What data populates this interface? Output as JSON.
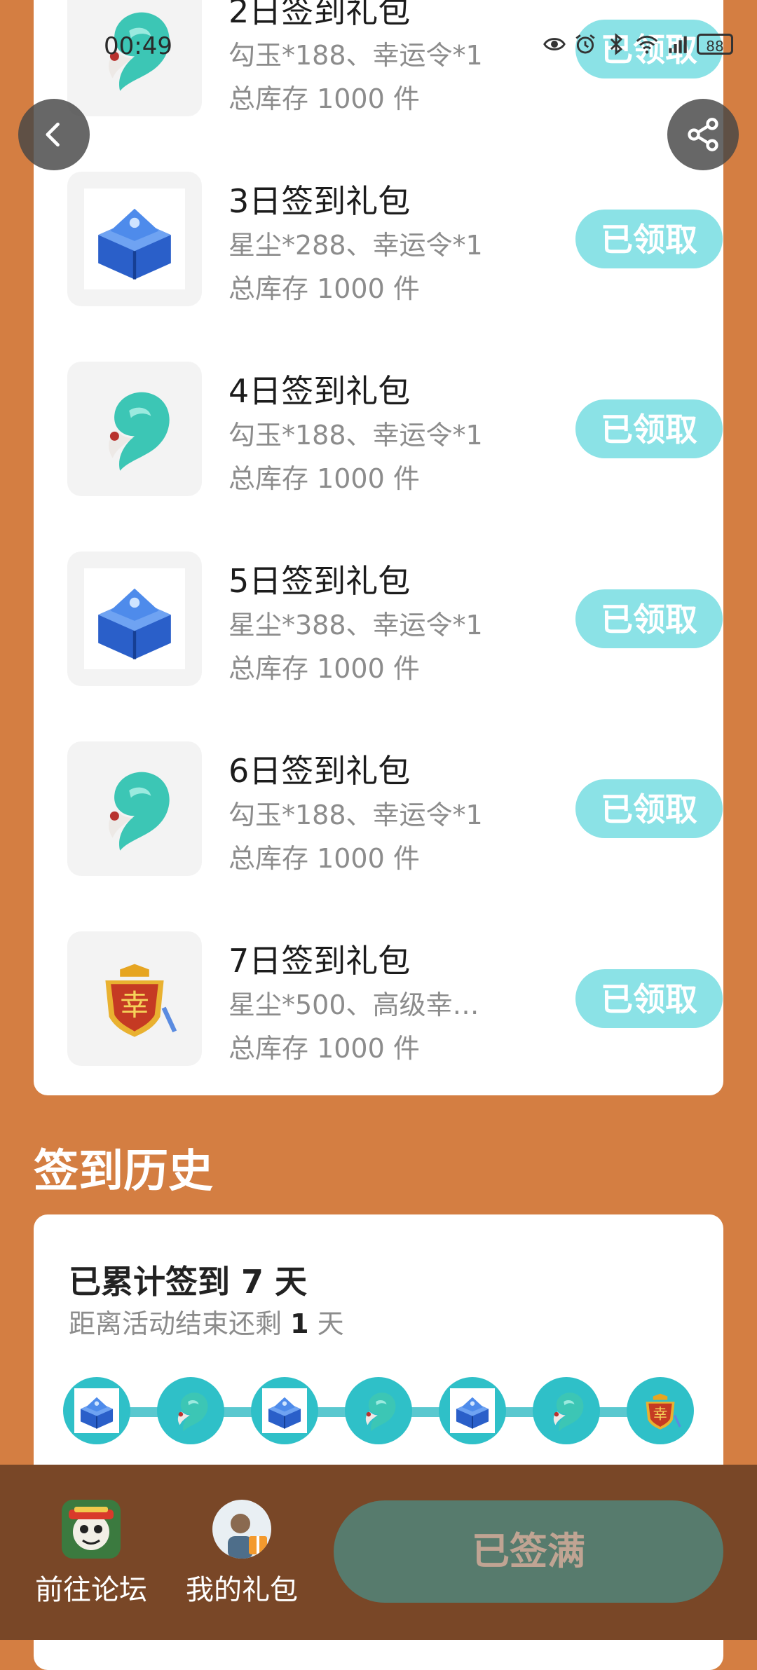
{
  "status_bar": {
    "time": "00:49",
    "battery": "88"
  },
  "nav": {
    "back_icon": "chevron-left-icon",
    "share_icon": "share-icon"
  },
  "gifts": [
    {
      "title": "2日签到礼包",
      "items": "勾玉*188、幸运令*1",
      "stock": "总库存 1000 件",
      "button": "已领取",
      "icon": "jade-magatama-icon"
    },
    {
      "title": "3日签到礼包",
      "items": "星尘*288、幸运令*1",
      "stock": "总库存 1000 件",
      "button": "已领取",
      "icon": "stardust-chest-icon"
    },
    {
      "title": "4日签到礼包",
      "items": "勾玉*188、幸运令*1",
      "stock": "总库存 1000 件",
      "button": "已领取",
      "icon": "jade-magatama-icon"
    },
    {
      "title": "5日签到礼包",
      "items": "星尘*388、幸运令*1",
      "stock": "总库存 1000 件",
      "button": "已领取",
      "icon": "stardust-chest-icon"
    },
    {
      "title": "6日签到礼包",
      "items": "勾玉*188、幸运令*1",
      "stock": "总库存 1000 件",
      "button": "已领取",
      "icon": "jade-magatama-icon"
    },
    {
      "title": "7日签到礼包",
      "items": "星尘*500、高级幸…",
      "stock": "总库存 1000 件",
      "button": "已领取",
      "icon": "lucky-token-icon"
    }
  ],
  "history": {
    "heading": "签到历史",
    "total_prefix": "已累计签到",
    "total_days": "7",
    "total_suffix": "天",
    "remaining_prefix": "距离活动结束还剩",
    "remaining_days": "1",
    "remaining_suffix": "天",
    "days": [
      "stardust-chest-icon",
      "jade-magatama-icon",
      "stardust-chest-icon",
      "jade-magatama-icon",
      "stardust-chest-icon",
      "jade-magatama-icon",
      "lucky-token-icon"
    ]
  },
  "bottom_bar": {
    "forum_label": "前往论坛",
    "gifts_label": "我的礼包",
    "signed_label": "已签满"
  },
  "colors": {
    "background": "#D47E42",
    "claimed_button": "#8BE2E6",
    "bottom_bar": "#794727",
    "signed_button": "#577B6D"
  }
}
